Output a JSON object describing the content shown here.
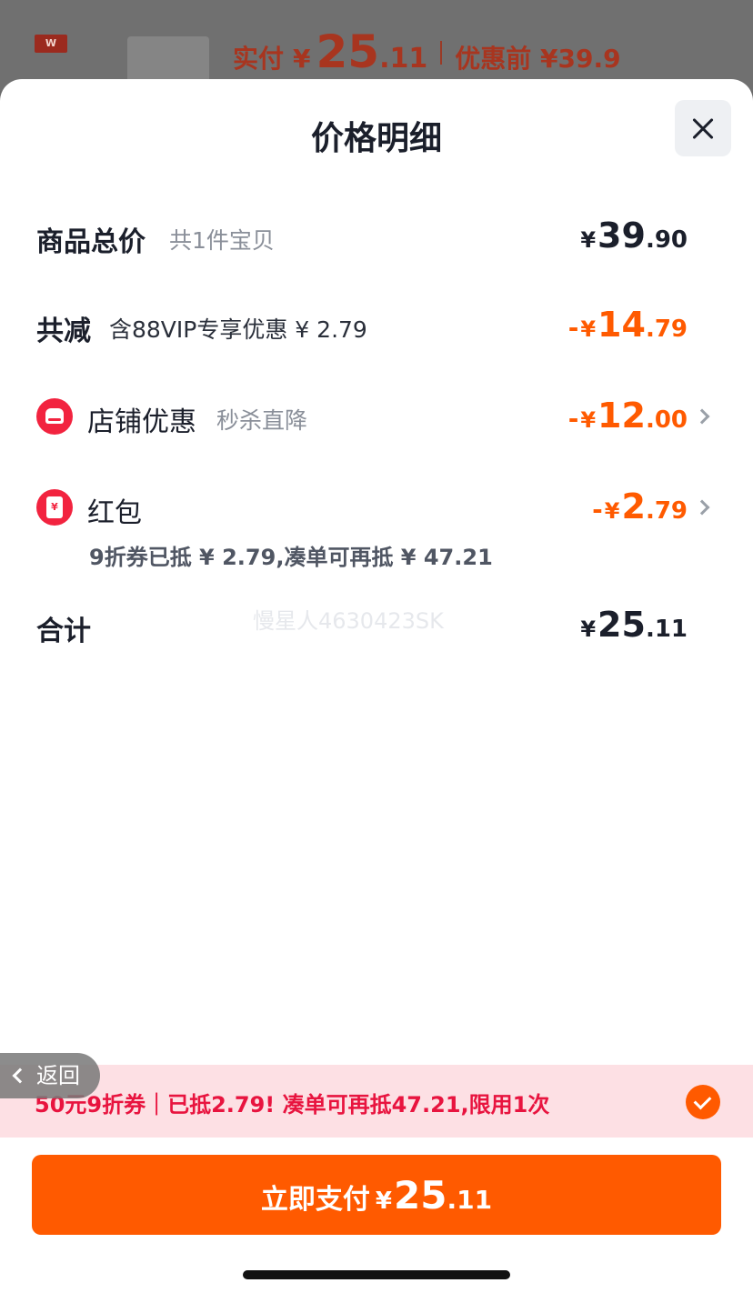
{
  "background_page": {
    "brand_logo": "W",
    "paid_label": "实付",
    "paid_yen": "¥",
    "paid_int": "25",
    "paid_dec": ".11",
    "original_text": "优惠前 ¥39.9"
  },
  "sheet": {
    "title": "价格明细",
    "close_icon": "close-icon"
  },
  "rows": {
    "subtotal": {
      "label": "商品总价",
      "sub": "共1件宝贝",
      "yen": "¥",
      "int": "39",
      "dec": ".90"
    },
    "discount_total": {
      "label": "共减",
      "sub": "含88VIP专享优惠 ¥ 2.79",
      "sign": "-",
      "yen": "¥",
      "int": "14",
      "dec": ".79"
    },
    "shop_discount": {
      "label": "店铺优惠",
      "sub": "秒杀直降",
      "sign": "-",
      "yen": "¥",
      "int": "12",
      "dec": ".00",
      "icon": "shop-icon"
    },
    "red_packet": {
      "label": "红包",
      "note": "9折券已抵 ¥ 2.79,凑单可再抵 ¥ 47.21",
      "sign": "-",
      "yen": "¥",
      "int": "2",
      "dec": ".79",
      "icon": "red-envelope-icon",
      "icon_glyph": "¥"
    },
    "total": {
      "label": "合计",
      "yen": "¥",
      "int": "25",
      "dec": ".11"
    }
  },
  "watermark": "慢星人463042​3SK",
  "coupon_banner": {
    "text": "50元9折券｜已抵2.79! 凑单可再抵47.21,限用1次",
    "checked": true
  },
  "back_button": {
    "label": "返回"
  },
  "pay_button": {
    "label": "立即支付",
    "yen": "¥",
    "int": "25",
    "dec": ".11"
  },
  "colors": {
    "accent": "#ff5a00",
    "coupon_text": "#e8143f",
    "coupon_bg": "#fde0e4",
    "icon_red": "#f2233f"
  }
}
